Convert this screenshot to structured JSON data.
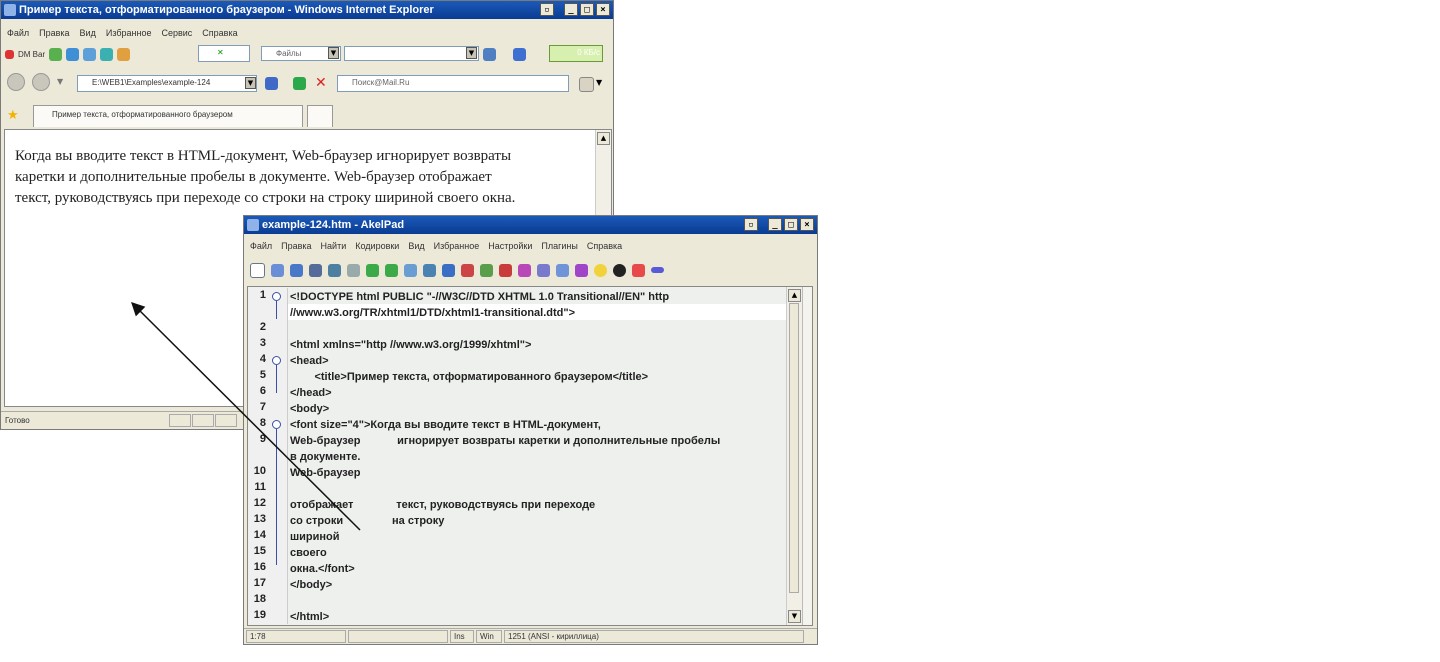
{
  "ie": {
    "title": "Пример текста, отформатированного браузером - Windows Internet Explorer",
    "menu": [
      "Файл",
      "Правка",
      "Вид",
      "Избранное",
      "Сервис",
      "Справка"
    ],
    "dm_bar_label": "DM Bar",
    "files_label": "Файлы",
    "progress_text": "0 КБ/с",
    "address": "E:\\WEB1\\Examples\\example-124",
    "search_placeholder": "Поиск@Mail.Ru",
    "tab_label": "Пример текста, отформатированного браузером",
    "body_lines": [
      "Когда вы вводите текст в HTML-документ, Web-браузер игнорирует возвраты",
      "каретки и дополнительные пробелы в документе. Web-браузер отображает",
      "текст, руководствуясь при переходе со строки на строку шириной своего окна."
    ],
    "status": "Готово"
  },
  "akelpad": {
    "title": "example-124.htm - AkelPad",
    "menu": [
      "Файл",
      "Правка",
      "Найти",
      "Кодировки",
      "Вид",
      "Избранное",
      "Настройки",
      "Плагины",
      "Справка"
    ],
    "line_numbers": [
      "1",
      "",
      "2",
      "3",
      "4",
      "5",
      "6",
      "7",
      "8",
      "9",
      "",
      "10",
      "11",
      "12",
      "13",
      "14",
      "15",
      "16",
      "17",
      "18",
      "19"
    ],
    "code_lines": [
      "<!DOCTYPE html PUBLIC \"-//W3C//DTD XHTML 1.0 Transitional//EN\" http",
      "//www.w3.org/TR/xhtml1/DTD/xhtml1-transitional.dtd\">",
      "",
      "<html xmlns=\"http //www.w3.org/1999/xhtml\">",
      "<head>",
      "        <title>Пример текста, отформатированного браузером</title>",
      "</head>",
      "<body>",
      "<font size=\"4\">Когда вы вводите текст в HTML-документ,",
      "Web-браузер            игнорирует возвраты каретки и дополнительные пробелы",
      "в документе.",
      "Web-браузер",
      "",
      "отображает              текст, руководствуясь при переходе",
      "со строки                на строку",
      "шириной",
      "своего",
      "окна.</font>",
      "</body>",
      "",
      "</html>"
    ],
    "status": {
      "position": "1:78",
      "mode": "Ins",
      "newline": "Win",
      "codepage": "1251  (ANSI - кириллица)"
    }
  }
}
